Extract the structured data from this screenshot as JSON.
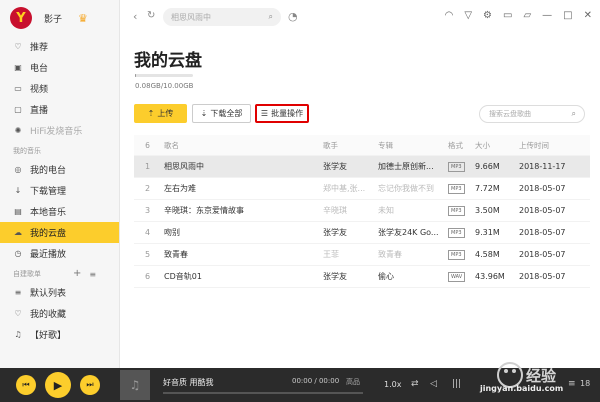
{
  "user": {
    "avatar_letter": "Y",
    "name": "影子"
  },
  "sidebar": {
    "items_top": [
      {
        "label": "推荐",
        "icon": "heart-icon",
        "glyph": "♡"
      },
      {
        "label": "电台",
        "icon": "radio-icon",
        "glyph": "▣"
      },
      {
        "label": "视频",
        "icon": "video-icon",
        "glyph": "▭"
      },
      {
        "label": "直播",
        "icon": "live-icon",
        "glyph": "▢"
      },
      {
        "label": "HiFi发烧音乐",
        "icon": "hifi-icon",
        "glyph": "✺"
      }
    ],
    "section_my_music": "我的音乐",
    "items_my": [
      {
        "label": "我的电台",
        "icon": "my-radio-icon",
        "glyph": "◎"
      },
      {
        "label": "下载管理",
        "icon": "download-icon",
        "glyph": "↓"
      },
      {
        "label": "本地音乐",
        "icon": "local-music-icon",
        "glyph": "▤"
      },
      {
        "label": "我的云盘",
        "icon": "cloud-icon",
        "glyph": "☁",
        "active": true
      },
      {
        "label": "最近播放",
        "icon": "clock-icon",
        "glyph": "◷"
      }
    ],
    "section_playlists": "自建歌单",
    "items_playlists": [
      {
        "label": "默认列表",
        "icon": "list-icon",
        "glyph": "≡"
      },
      {
        "label": "我的收藏",
        "icon": "heart-icon",
        "glyph": "♡"
      },
      {
        "label": "【好歌】",
        "icon": "music-note-icon",
        "glyph": "♫"
      }
    ]
  },
  "topbar": {
    "search_placeholder": "相思风雨中"
  },
  "main": {
    "title": "我的云盘",
    "storage_text": "0.08GB/10.00GB",
    "storage_fraction": 0.008,
    "btn_upload": "上传",
    "btn_download_all": "下载全部",
    "btn_batch": "批量操作",
    "table_search_placeholder": "搜索云盘歌曲"
  },
  "table": {
    "header": {
      "num": "6",
      "name": "歌名",
      "singer": "歌手",
      "album": "专辑",
      "format": "格式",
      "size": "大小",
      "date": "上传时间"
    },
    "rows": [
      {
        "num": "1",
        "name": "相思风雨中",
        "singer": "张学友",
        "album": "加德士原创新...",
        "format": "MP3",
        "size": "9.66M",
        "date": "2018-11-17",
        "muted_singer": false,
        "muted_album": false
      },
      {
        "num": "2",
        "name": "左右为难",
        "singer": "郑中基,张...",
        "album": "忘记你我做不到",
        "format": "MP3",
        "size": "7.72M",
        "date": "2018-05-07",
        "muted_singer": true,
        "muted_album": true
      },
      {
        "num": "3",
        "name": "辛晓琪：东京爱情故事",
        "singer": "辛晓琪",
        "album": "未知",
        "format": "MP3",
        "size": "3.50M",
        "date": "2018-05-07",
        "muted_singer": true,
        "muted_album": true
      },
      {
        "num": "4",
        "name": "吻别",
        "singer": "张学友",
        "album": "张学友24K Go...",
        "format": "MP3",
        "size": "9.31M",
        "date": "2018-05-07",
        "muted_singer": false,
        "muted_album": false
      },
      {
        "num": "5",
        "name": "致青春",
        "singer": "王菲",
        "album": "致青春",
        "format": "MP3",
        "size": "4.58M",
        "date": "2018-05-07",
        "muted_singer": true,
        "muted_album": true
      },
      {
        "num": "6",
        "name": "CD音轨01",
        "singer": "张学友",
        "album": "偷心",
        "format": "WAV",
        "size": "43.96M",
        "date": "2018-05-07",
        "muted_singer": false,
        "muted_album": false
      }
    ]
  },
  "player": {
    "now_playing": "好音质 用酷我",
    "time": "00:00 / 00:00",
    "quality": "高品",
    "speed": "1.0x",
    "queue_count": "18"
  },
  "watermark": {
    "text": "jingyan.baidu.com"
  }
}
